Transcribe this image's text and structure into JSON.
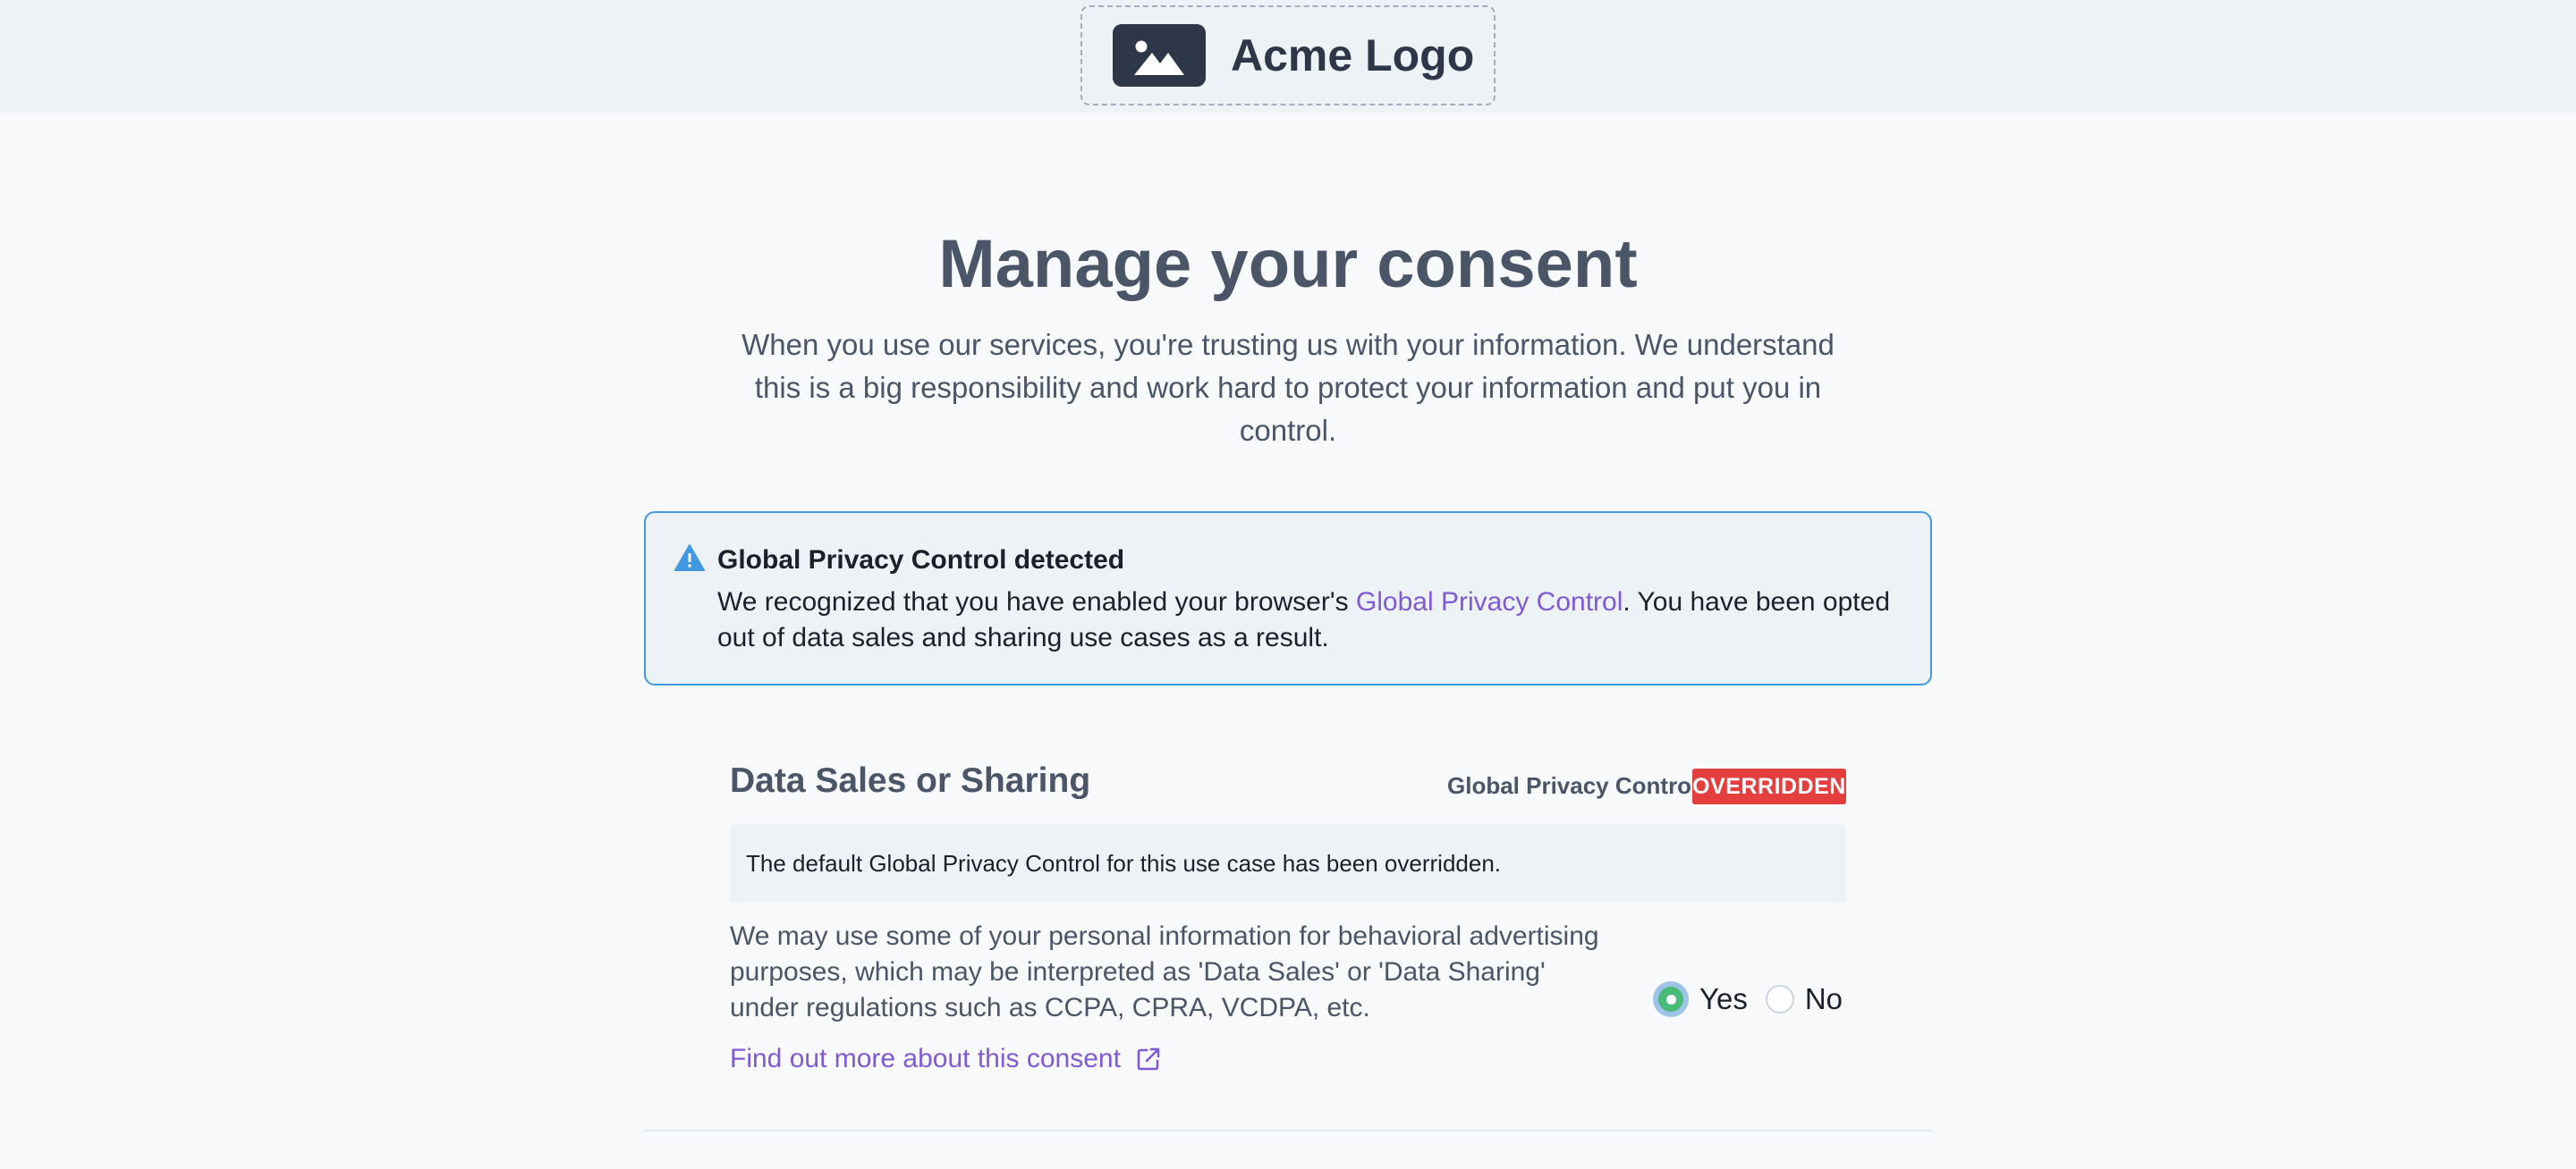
{
  "header": {
    "logo_text": "Acme Logo",
    "logo_icon": "image-icon"
  },
  "main": {
    "title": "Manage your consent",
    "intro": "When you use our services, you're trusting us with your information. We understand this is a big responsibility and work hard to protect your information and put you in control."
  },
  "gpc_alert": {
    "icon": "warning-icon",
    "title": "Global Privacy Control detected",
    "body_prefix": "We recognized that you have enabled your browser's ",
    "link_text": "Global Privacy Control",
    "body_suffix": ". You have been opted out of data sales and sharing use cases as a result."
  },
  "consent": {
    "title": "Data Sales or Sharing",
    "gpc_label": "Global Privacy Control",
    "badge": "OVERRIDDEN",
    "override_note": "The default Global Privacy Control for this use case has been overridden.",
    "description": "We may use some of your personal information for behavioral advertising purposes, which may be interpreted as 'Data Sales' or 'Data Sharing' under regulations such as CCPA, CPRA, VCDPA, etc.",
    "find_more": "Find out more about this consent",
    "find_more_icon": "external-link-icon",
    "options": {
      "yes": "Yes",
      "no": "No"
    },
    "selected": "Yes"
  },
  "colors": {
    "accent_link": "#805ad5",
    "badge_red": "#e53e3e",
    "alert_border": "#4299e1",
    "radio_selected": "#48bb78"
  }
}
